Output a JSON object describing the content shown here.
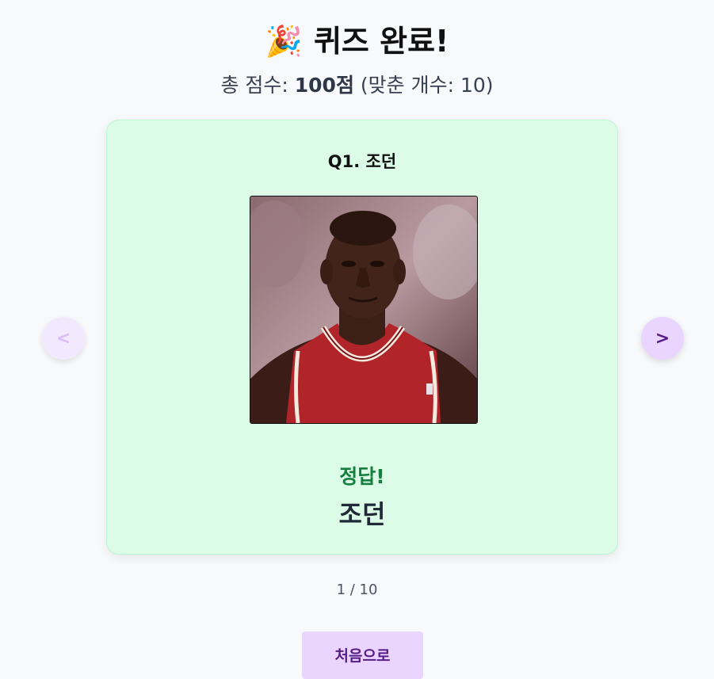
{
  "header": {
    "emoji": "🎉",
    "title": "퀴즈 완료!",
    "score_prefix": "총 점수: ",
    "score_value": "100점",
    "score_suffix": " (맞춘 개수: 10)"
  },
  "card": {
    "question_label": "Q1. 조던",
    "result_text": "정답!",
    "answer_text": "조던",
    "colors": {
      "background": "#dcfce7",
      "result": "#15803d"
    }
  },
  "navigation": {
    "prev_label": "<",
    "next_label": ">"
  },
  "pagination": {
    "text": "1 / 10"
  },
  "actions": {
    "home_label": "처음으로"
  }
}
